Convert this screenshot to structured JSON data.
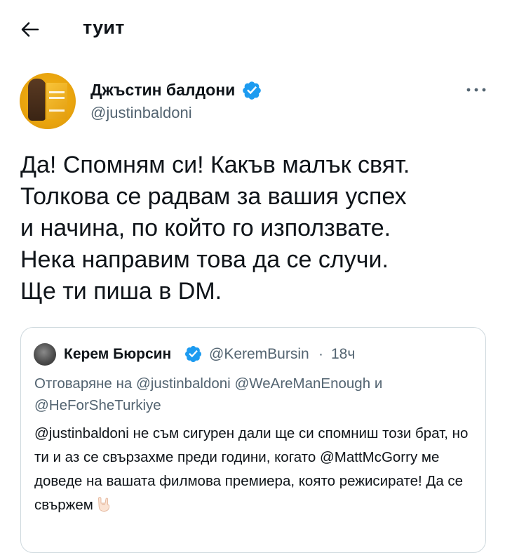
{
  "header": {
    "back_icon": "arrow-left-icon",
    "title": "туит"
  },
  "author": {
    "display_name": "Джъстин балдони",
    "handle": "@justinbaldoni",
    "verified": true,
    "more_icon": "more-dots-icon"
  },
  "tweet": {
    "text": "Да! Спомням си! Какъв малък свят.\nТолкова се радвам за вашия успех\nи начина, по който го използвате.\nНека направим това да се случи.\nЩе ти пиша в DM."
  },
  "quoted_tweet": {
    "display_name": "Керем Бюрсин",
    "verified": true,
    "handle": "@KeremBursin",
    "separator": "·",
    "time": "18ч",
    "reply_prefix": "Отговаряне на",
    "reply_user_1": "@justinbaldoni",
    "reply_user_2": "@WeAreManEnough",
    "reply_and": "и",
    "reply_user_3": "@HeForSheTurkiye",
    "mention_1": "@justinbaldoni",
    "text_1": " не съм сигурен дали ще си спомниш този брат, но ти и аз се свързахме преди години, когато ",
    "mention_2": "@MattMcGorry",
    "text_2": " ме доведе на вашата филмова премиера, която режисирате! Да се свържем",
    "emoji_icon": "sign-of-the-horns-emoji"
  },
  "colors": {
    "text": "#0f1419",
    "secondary": "#536471",
    "verified_badge": "#1d9bf0",
    "border": "#cfd9de"
  }
}
